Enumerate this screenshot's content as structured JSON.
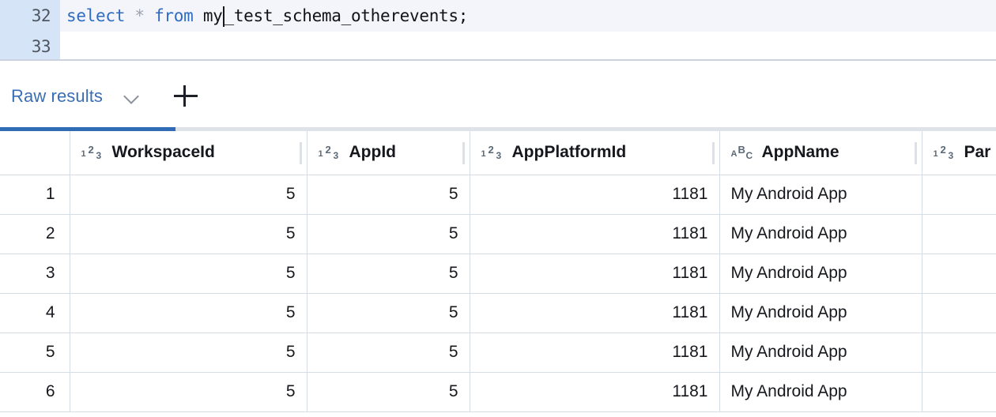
{
  "editor": {
    "lines": [
      {
        "number": "32",
        "current": true,
        "tokens": [
          {
            "kind": "kw",
            "text": "select"
          },
          {
            "kind": "sp",
            "text": " "
          },
          {
            "kind": "op",
            "text": "*"
          },
          {
            "kind": "sp",
            "text": " "
          },
          {
            "kind": "kw",
            "text": "from"
          },
          {
            "kind": "sp",
            "text": " "
          },
          {
            "kind": "id",
            "text": "my"
          },
          {
            "kind": "caret",
            "text": ""
          },
          {
            "kind": "id",
            "text": "_test_schema_otherevents;"
          }
        ],
        "text": "select * from my_test_schema_otherevents;"
      },
      {
        "number": "33",
        "current": false,
        "tokens": [],
        "text": ""
      }
    ]
  },
  "tabbar": {
    "active_tab_label": "Raw results",
    "chevron_icon": "chevron-down-icon",
    "add_icon": "plus-icon",
    "accent_color": "#2f6cb5"
  },
  "grid": {
    "rownum_header": "",
    "columns": [
      {
        "name": "WorkspaceId",
        "type": "number",
        "type_icon": "number-type-icon",
        "align": "right"
      },
      {
        "name": "AppId",
        "type": "number",
        "type_icon": "number-type-icon",
        "align": "right"
      },
      {
        "name": "AppPlatformId",
        "type": "number",
        "type_icon": "number-type-icon",
        "align": "right"
      },
      {
        "name": "AppName",
        "type": "text",
        "type_icon": "text-type-icon",
        "align": "left"
      },
      {
        "name": "Par",
        "type": "number",
        "type_icon": "number-type-icon",
        "align": "right"
      }
    ],
    "rows": [
      {
        "n": "1",
        "cells": [
          "5",
          "5",
          "1181",
          "My Android App",
          ""
        ]
      },
      {
        "n": "2",
        "cells": [
          "5",
          "5",
          "1181",
          "My Android App",
          ""
        ]
      },
      {
        "n": "3",
        "cells": [
          "5",
          "5",
          "1181",
          "My Android App",
          ""
        ]
      },
      {
        "n": "4",
        "cells": [
          "5",
          "5",
          "1181",
          "My Android App",
          ""
        ]
      },
      {
        "n": "5",
        "cells": [
          "5",
          "5",
          "1181",
          "My Android App",
          ""
        ]
      },
      {
        "n": "6",
        "cells": [
          "5",
          "5",
          "1181",
          "My Android App",
          ""
        ]
      }
    ]
  }
}
